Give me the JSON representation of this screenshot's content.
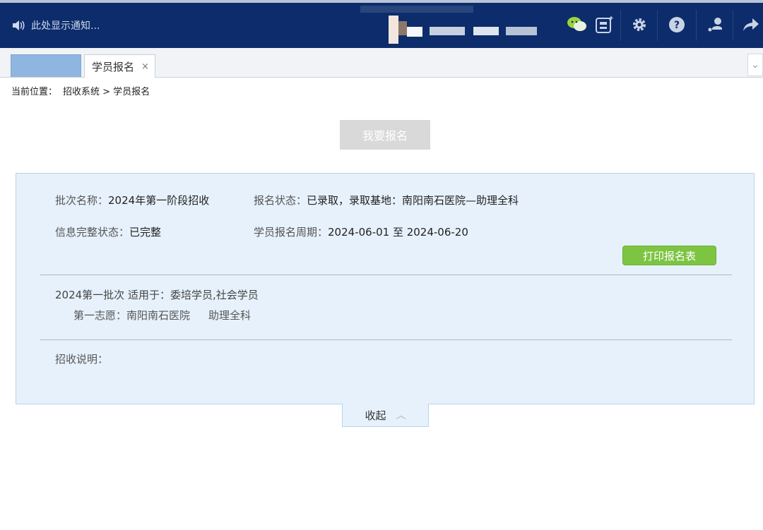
{
  "header": {
    "notice": "此处显示通知...",
    "icons": [
      "speaker-icon",
      "wechat-icon",
      "badge-icon",
      "gear-icon",
      "help-icon",
      "user-icon",
      "share-icon"
    ]
  },
  "tabs": {
    "active_label": "学员报名",
    "close_glyph": "×",
    "scroll_glyph": "⌄"
  },
  "breadcrumb": {
    "prefix": "当前位置：",
    "path": "招收系统 > 学员报名"
  },
  "signup_button": "我要报名",
  "batch_info": {
    "batch_name_label": "批次名称：",
    "batch_name": "2024年第一阶段招收",
    "status_label": "报名状态：",
    "status": "已录取，录取基地：南阳南石医院—助理全科",
    "completeness_label": "信息完整状态：",
    "completeness": "已完整",
    "period_label": "学员报名周期：",
    "period": "2024-06-01 至 2024-06-20",
    "print_button": "打印报名表",
    "applies": "2024第一批次 适用于：委培学员,社会学员",
    "choice_label": "第一志愿：",
    "choice_hospital": "南阳南石医院",
    "choice_major": "助理全科",
    "notes_label": "招收说明："
  },
  "collapse": {
    "label": "收起",
    "glyph": "︿"
  },
  "colors": {
    "header_bg": "#0d2c6b",
    "panel_bg": "#e6f1fc",
    "print_button": "#7dc443",
    "active_tab_home": "#8fb6e0"
  }
}
